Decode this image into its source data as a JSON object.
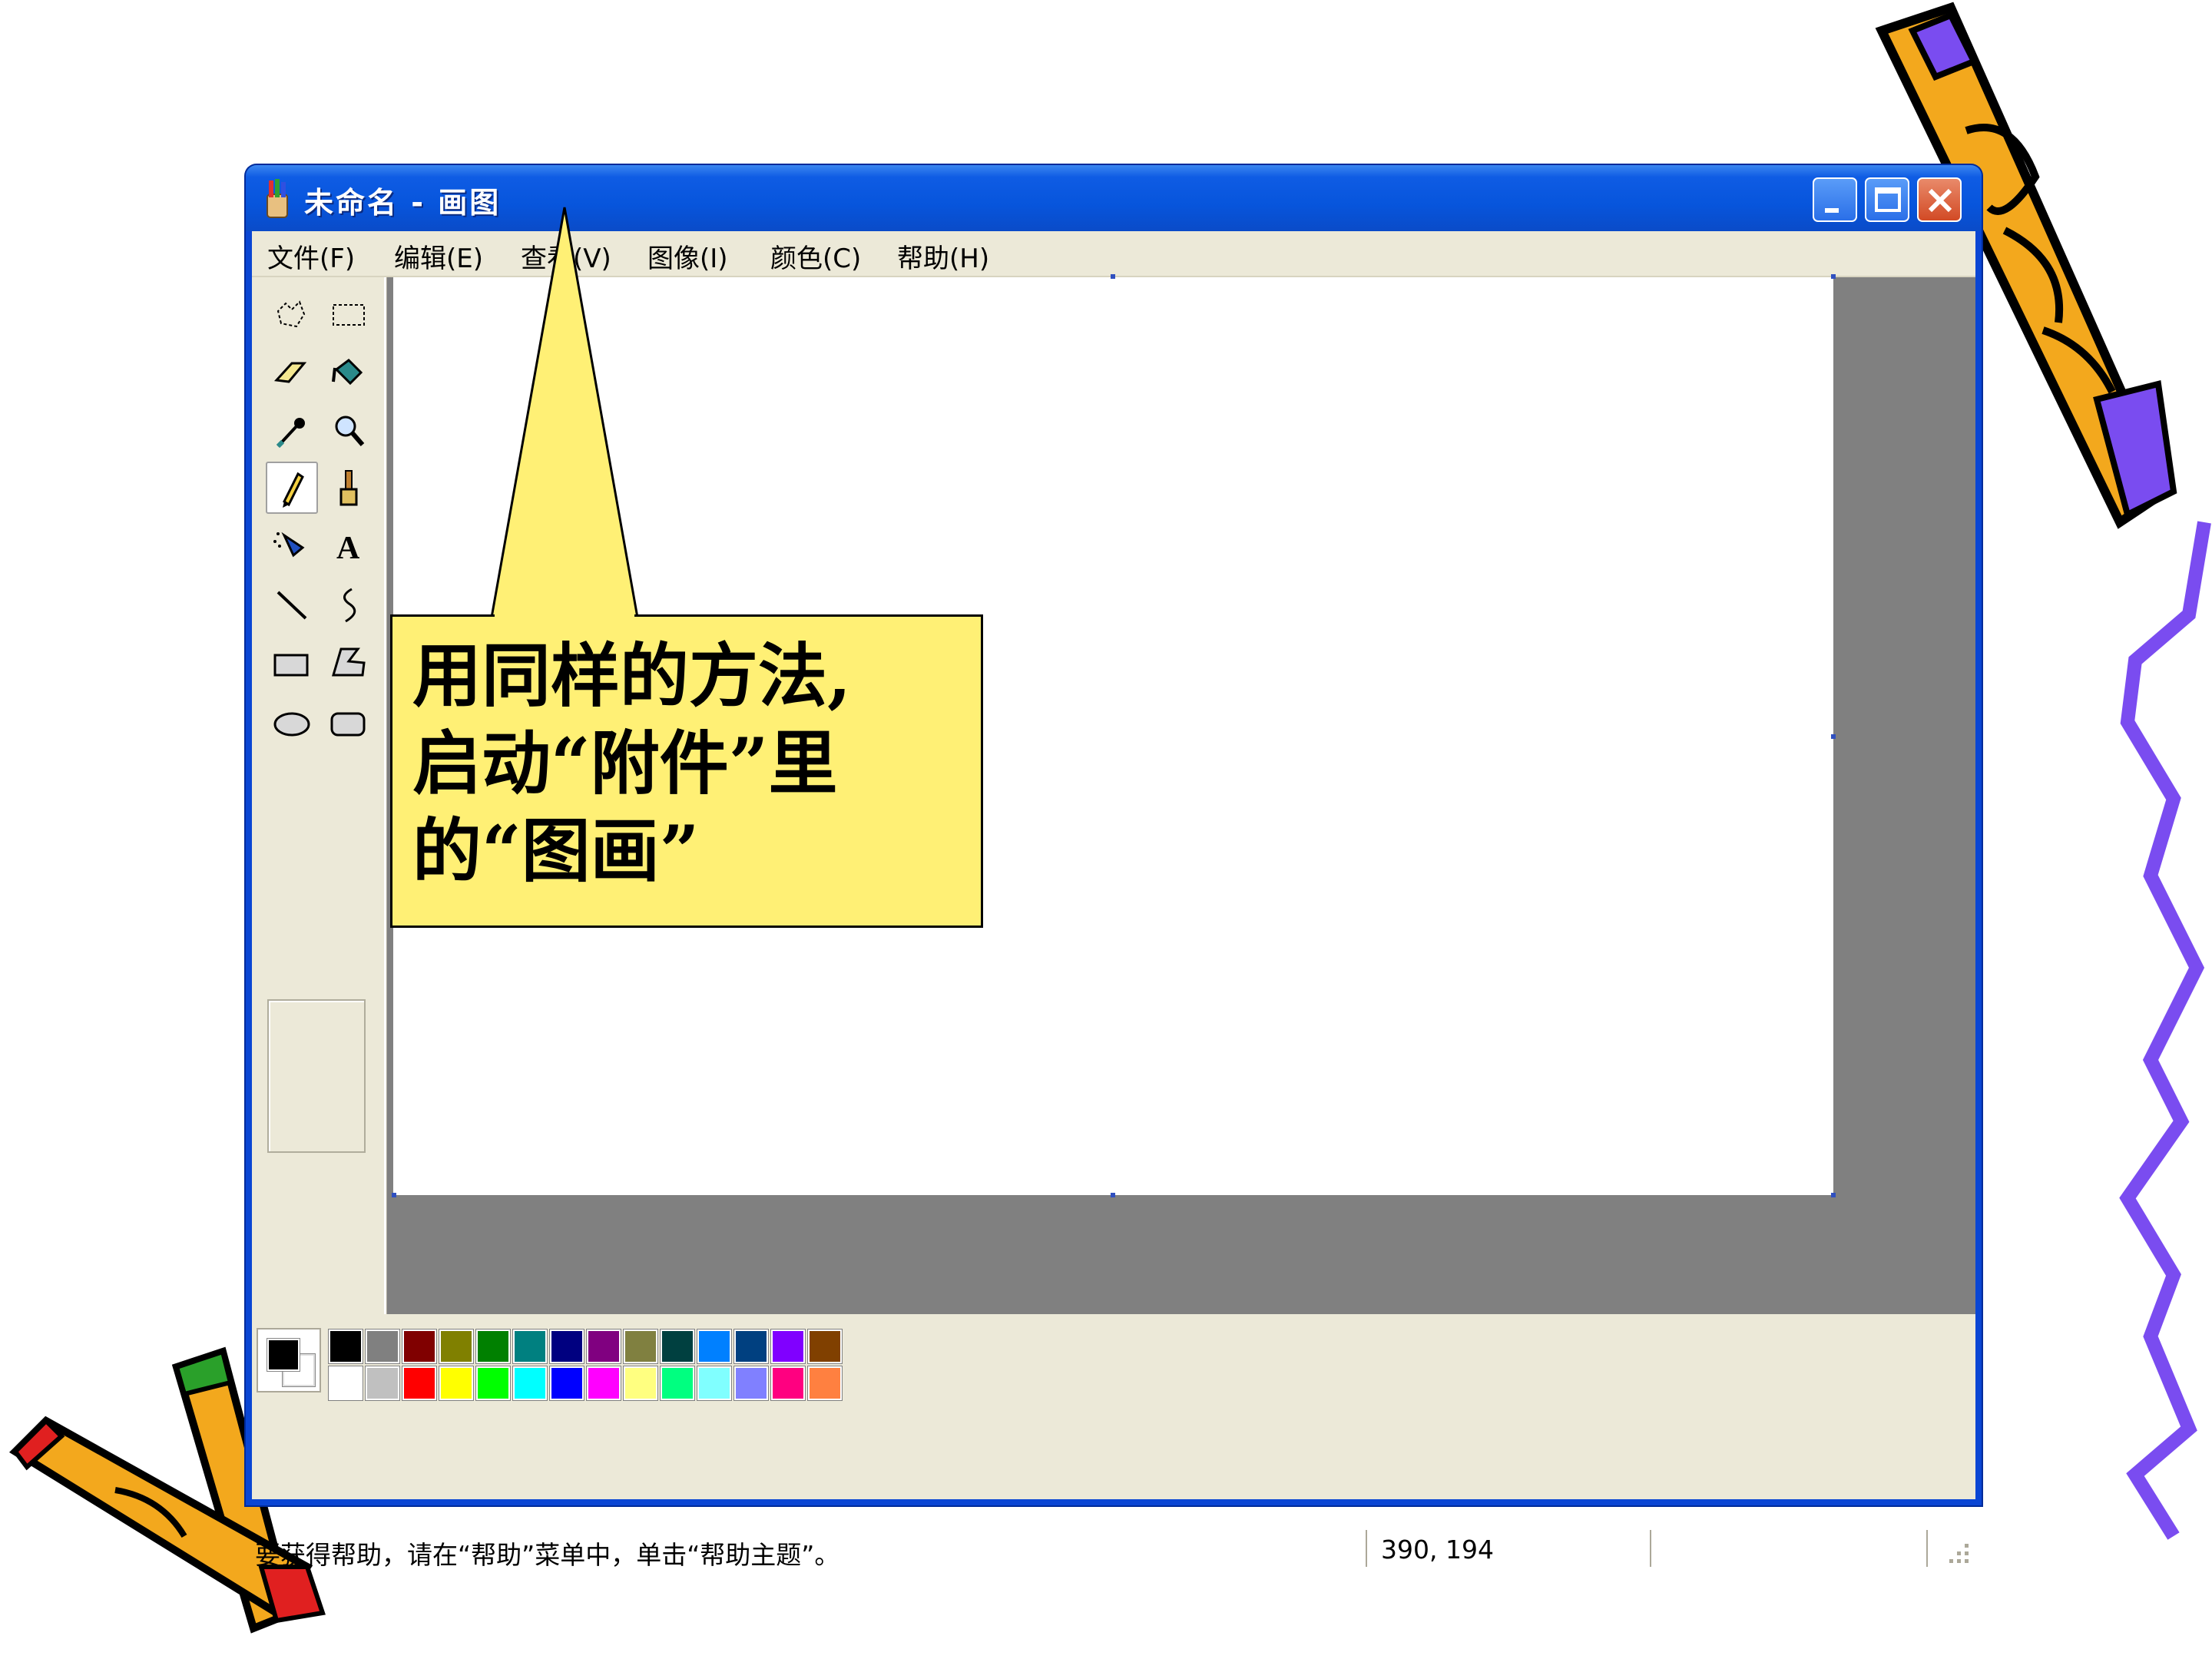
{
  "window": {
    "title": "未命名 - 画图"
  },
  "menu": [
    {
      "label": "文件(F)"
    },
    {
      "label": "编辑(E)"
    },
    {
      "label": "查看(V)"
    },
    {
      "label": "图像(I)"
    },
    {
      "label": "颜色(C)"
    },
    {
      "label": "帮助(H)"
    }
  ],
  "tools": [
    {
      "icon": "free-select-icon"
    },
    {
      "icon": "rect-select-icon"
    },
    {
      "icon": "eraser-icon"
    },
    {
      "icon": "fill-icon"
    },
    {
      "icon": "color-picker-icon"
    },
    {
      "icon": "magnifier-icon"
    },
    {
      "icon": "pencil-icon",
      "active": true
    },
    {
      "icon": "brush-icon"
    },
    {
      "icon": "airbrush-icon"
    },
    {
      "icon": "text-icon",
      "glyph": "A"
    },
    {
      "icon": "line-icon"
    },
    {
      "icon": "curve-icon"
    },
    {
      "icon": "rectangle-icon"
    },
    {
      "icon": "polygon-icon"
    },
    {
      "icon": "ellipse-icon"
    },
    {
      "icon": "rounded-rect-icon"
    }
  ],
  "palette": {
    "foreground": "#000000",
    "background": "#ffffff",
    "row1": [
      "#000000",
      "#808080",
      "#800000",
      "#808000",
      "#008000",
      "#008080",
      "#000080",
      "#800080",
      "#808040",
      "#004040",
      "#0080ff",
      "#004080",
      "#8000ff",
      "#804000"
    ],
    "row2": [
      "#ffffff",
      "#c0c0c0",
      "#ff0000",
      "#ffff00",
      "#00ff00",
      "#00ffff",
      "#0000ff",
      "#ff00ff",
      "#ffff80",
      "#00ff80",
      "#80ffff",
      "#8080ff",
      "#ff0080",
      "#ff8040"
    ]
  },
  "status": {
    "help_text": "要获得帮助，请在“帮助”菜单中，单击“帮助主题”。",
    "coords": "390, 194"
  },
  "callout": {
    "lines": [
      "用同样的方法,",
      "启动“附件”里",
      "的“图画”"
    ]
  }
}
